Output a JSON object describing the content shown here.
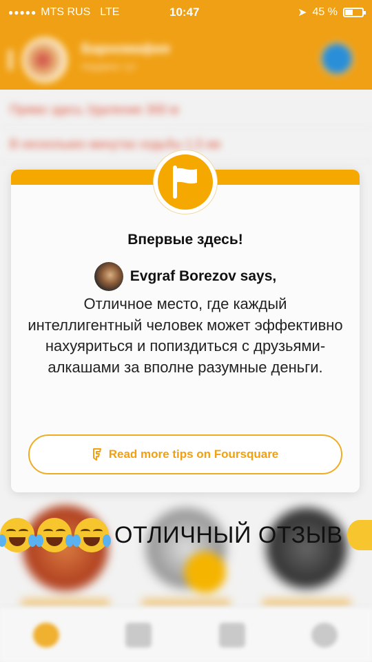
{
  "status_bar": {
    "signal": "●●●●●",
    "carrier": "MTS RUS",
    "network": "LTE",
    "time": "10:47",
    "battery_text": "45 %",
    "battery_level": 0.45
  },
  "background": {
    "venue_name": "Барномафия",
    "venue_subtitle": "Недавно тут",
    "line_1": "Прямо здесь Удаление 300 м",
    "line_2": "В нескольких минутах ходьбы 1,5 км"
  },
  "tip_card": {
    "title": "Впервые здесь!",
    "author": "Evgraf Borezov says,",
    "text": "Отличное место, где каждый интеллигентный человек может эффективно нахуяриться и попиздиться с друзьями-алкашами за вполне разумные деньги.",
    "more_button": "Read more tips on Foursquare",
    "accent_color": "#f5a800"
  },
  "caption": {
    "text": "ОТЛИЧНЫЙ ОТЗЫВ"
  }
}
